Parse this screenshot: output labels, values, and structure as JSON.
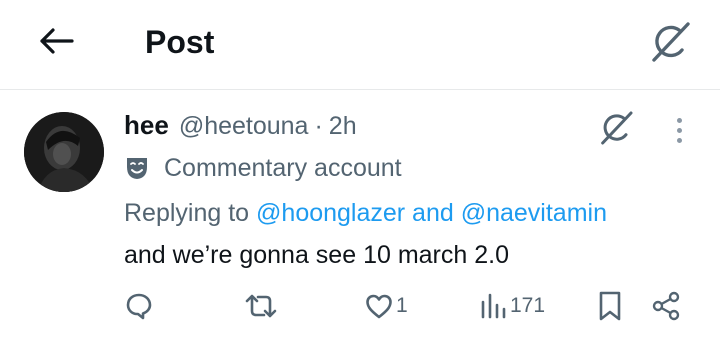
{
  "header": {
    "title": "Post",
    "back_icon": "arrow-left-icon",
    "right_icon": "grok-icon"
  },
  "post": {
    "display_name": "hee",
    "handle": "@heetouna",
    "separator": "·",
    "time": "2h",
    "label_icon": "theater-mask-icon",
    "label": "Commentary account",
    "reply_prefix": "Replying to",
    "reply_mentions": "@hoonglazer and @naevitamin",
    "text": "and we’re gonna see 10 march 2.0",
    "likes": "1",
    "views": "171"
  },
  "colors": {
    "text": "#0f1419",
    "secondary": "#536471",
    "link": "#1d9bf0",
    "divider": "#e7e9ea"
  }
}
